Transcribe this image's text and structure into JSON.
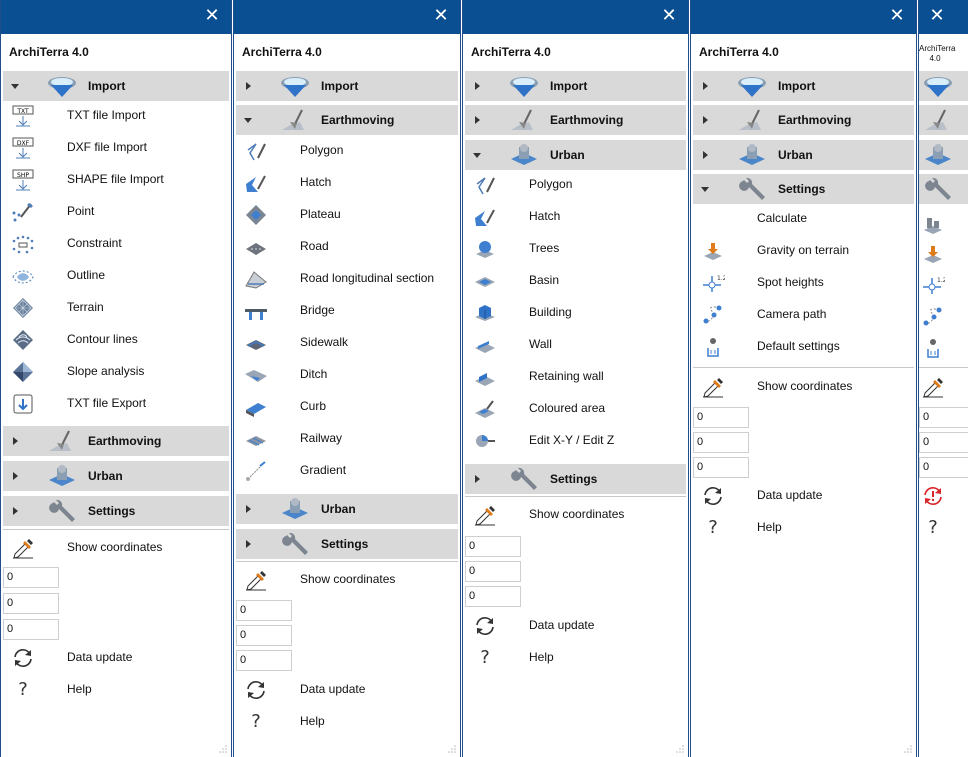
{
  "app_title": "ArchiTerra 4.0",
  "app_title_line1": "ArchiTerra",
  "app_title_line2": "4.0",
  "close_glyph": "✕",
  "sections": {
    "import": "Import",
    "earthmoving": "Earthmoving",
    "urban": "Urban",
    "settings": "Settings"
  },
  "import_items": [
    "TXT file Import",
    "DXF file Import",
    "SHAPE file Import",
    "Point",
    "Constraint",
    "Outline",
    "Terrain",
    "Contour lines",
    "Slope analysis",
    "TXT file Export"
  ],
  "import_icon_tags": [
    "TXT",
    "DXF",
    "SHP"
  ],
  "earthmoving_items": [
    "Polygon",
    "Hatch",
    "Plateau",
    "Road",
    "Road longitudinal section",
    "Bridge",
    "Sidewalk",
    "Ditch",
    "Curb",
    "Railway",
    "Gradient"
  ],
  "urban_items": [
    "Polygon",
    "Hatch",
    "Trees",
    "Basin",
    "Building",
    "Wall",
    "Retaining wall",
    "Coloured area",
    "Edit X-Y / Edit Z"
  ],
  "settings_items": [
    "Calculate",
    "Gravity on terrain",
    "Spot heights",
    "Camera path",
    "Default settings"
  ],
  "show_coordinates": "Show coordinates",
  "coordinates": [
    "0",
    "0",
    "0"
  ],
  "data_update": "Data update",
  "help": "Help",
  "help_glyph": "?",
  "colors": {
    "title_bar": "#0b4f93",
    "section_bg": "#d9d9d9",
    "alert_red": "#d9262b"
  }
}
